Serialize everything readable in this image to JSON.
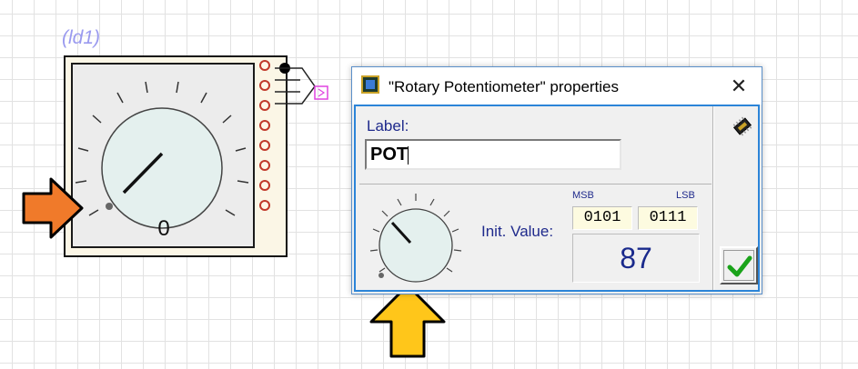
{
  "canvas": {
    "component_id": "(ld1)",
    "component_value": "0",
    "pin_count": 8
  },
  "dialog": {
    "title": "\"Rotary Potentiometer\" properties",
    "close_glyph": "✕",
    "label_caption": "Label:",
    "label_value": "POT",
    "init_value_caption": "Init. Value:",
    "msb_caption": "MSB",
    "lsb_caption": "LSB",
    "msb_bits": "0101",
    "lsb_bits": "0111",
    "decimal_value": "87",
    "ok_icon": "checkmark-icon",
    "side_icon": "chip-icon"
  },
  "colors": {
    "orange_arrow": "#f07a2a",
    "yellow_arrow": "#ffc61a",
    "pin_outline": "#c0392b",
    "accent_blue": "#2b84d8",
    "ok_check": "#1aa31a"
  }
}
